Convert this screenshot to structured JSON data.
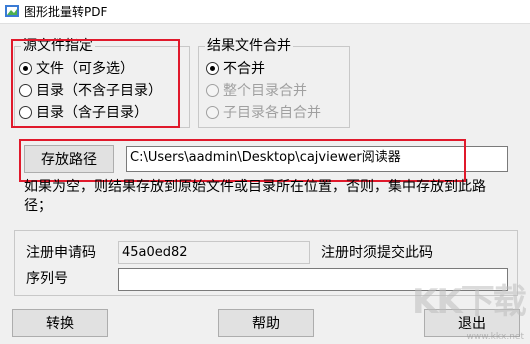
{
  "window": {
    "title": "图形批量转PDF"
  },
  "source_group": {
    "legend": "源文件指定",
    "options": [
      {
        "label": "文件（可多选）",
        "checked": true
      },
      {
        "label": "目录（不含子目录）",
        "checked": false
      },
      {
        "label": "目录（含子目录）",
        "checked": false
      }
    ]
  },
  "merge_group": {
    "legend": "结果文件合并",
    "options": [
      {
        "label": "不合并",
        "checked": true,
        "disabled": false
      },
      {
        "label": "整个目录合并",
        "checked": false,
        "disabled": true
      },
      {
        "label": "子目录各自合并",
        "checked": false,
        "disabled": true
      }
    ]
  },
  "save_path": {
    "button_label": "存放路径",
    "value": "C:\\Users\\aadmin\\Desktop\\cajviewer阅读器",
    "hint": "如果为空，则结果存放到原始文件或目录所在位置，否则，集中存放到此路径；"
  },
  "registration": {
    "request_code_label": "注册申请码",
    "request_code_value": "45a0ed82",
    "request_code_note": "注册时须提交此码",
    "serial_label": "序列号",
    "serial_value": ""
  },
  "buttons": {
    "convert": "转换",
    "help": "帮助",
    "exit": "退出"
  },
  "watermark": {
    "logo": "KK下载",
    "url": "www.kkx.net"
  },
  "colors": {
    "highlight": "#e0192b",
    "background": "#f0f0f0"
  }
}
